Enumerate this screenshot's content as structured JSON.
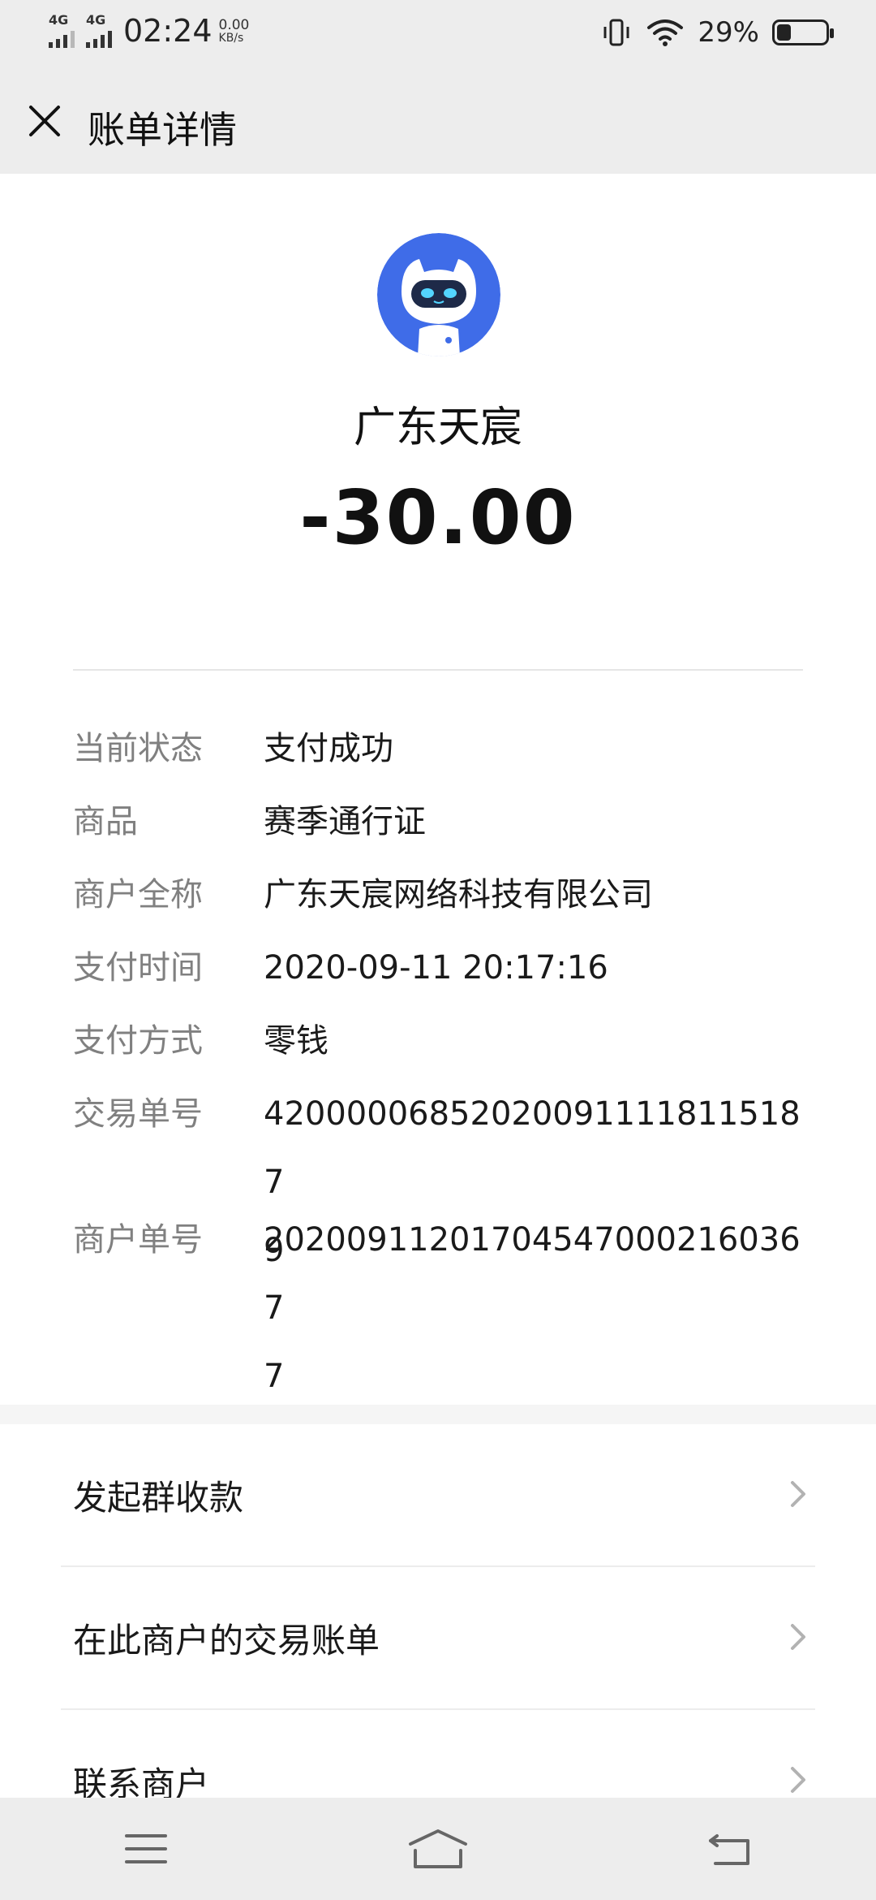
{
  "status_bar": {
    "net1": "4G",
    "net2": "4G",
    "time": "02:24",
    "speed_value": "0.00",
    "speed_unit": "KB/s",
    "battery": "29%",
    "battery_level": 0.29
  },
  "header": {
    "title": "账单详情",
    "close_icon": "close-icon"
  },
  "summary": {
    "merchant_name": "广东天宸",
    "amount": "-30.00",
    "avatar_icon": "robot-avatar-icon",
    "avatar_color": "#3f6ce8"
  },
  "details": [
    {
      "label": "当前状态",
      "value": "支付成功"
    },
    {
      "label": "商品",
      "value": "赛季通行证"
    },
    {
      "label": "商户全称",
      "value": "广东天宸网络科技有限公司"
    },
    {
      "label": "支付时间",
      "value": "2020-09-11 20:17:16"
    },
    {
      "label": "支付方式",
      "value": "零钱"
    },
    {
      "label": "交易单号",
      "value": "420000068520200911118115187\n9"
    },
    {
      "label": "商户单号",
      "value": "202009112017045470002160367\n7"
    }
  ],
  "actions": [
    {
      "label": "发起群收款"
    },
    {
      "label": "在此商户的交易账单"
    },
    {
      "label": "联系商户"
    }
  ],
  "nav_bar": {
    "menu_icon": "menu-icon",
    "home_icon": "home-icon",
    "back_icon": "back-icon"
  }
}
